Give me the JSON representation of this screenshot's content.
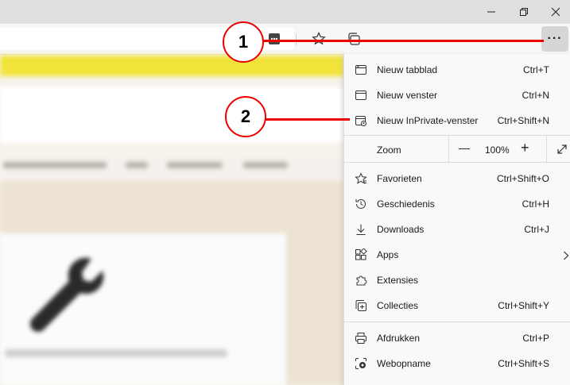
{
  "menu": {
    "new_tab": {
      "label": "Nieuw tabblad",
      "shortcut": "Ctrl+T"
    },
    "new_window": {
      "label": "Nieuw venster",
      "shortcut": "Ctrl+N"
    },
    "new_inprivate": {
      "label": "Nieuw InPrivate-venster",
      "shortcut": "Ctrl+Shift+N"
    },
    "zoom": {
      "label": "Zoom",
      "minus": "—",
      "value": "100%",
      "plus": "+"
    },
    "favorites": {
      "label": "Favorieten",
      "shortcut": "Ctrl+Shift+O"
    },
    "history": {
      "label": "Geschiedenis",
      "shortcut": "Ctrl+H"
    },
    "downloads": {
      "label": "Downloads",
      "shortcut": "Ctrl+J"
    },
    "apps": {
      "label": "Apps"
    },
    "extensions": {
      "label": "Extensies"
    },
    "collections": {
      "label": "Collecties",
      "shortcut": "Ctrl+Shift+Y"
    },
    "print": {
      "label": "Afdrukken",
      "shortcut": "Ctrl+P"
    },
    "web_capture": {
      "label": "Webopname",
      "shortcut": "Ctrl+Shift+S"
    }
  },
  "toolbar": {
    "more_label": "···"
  },
  "callouts": {
    "one": "1",
    "two": "2"
  },
  "colors": {
    "callout": "#e00000",
    "accent_yellow": "#f2e33a"
  }
}
